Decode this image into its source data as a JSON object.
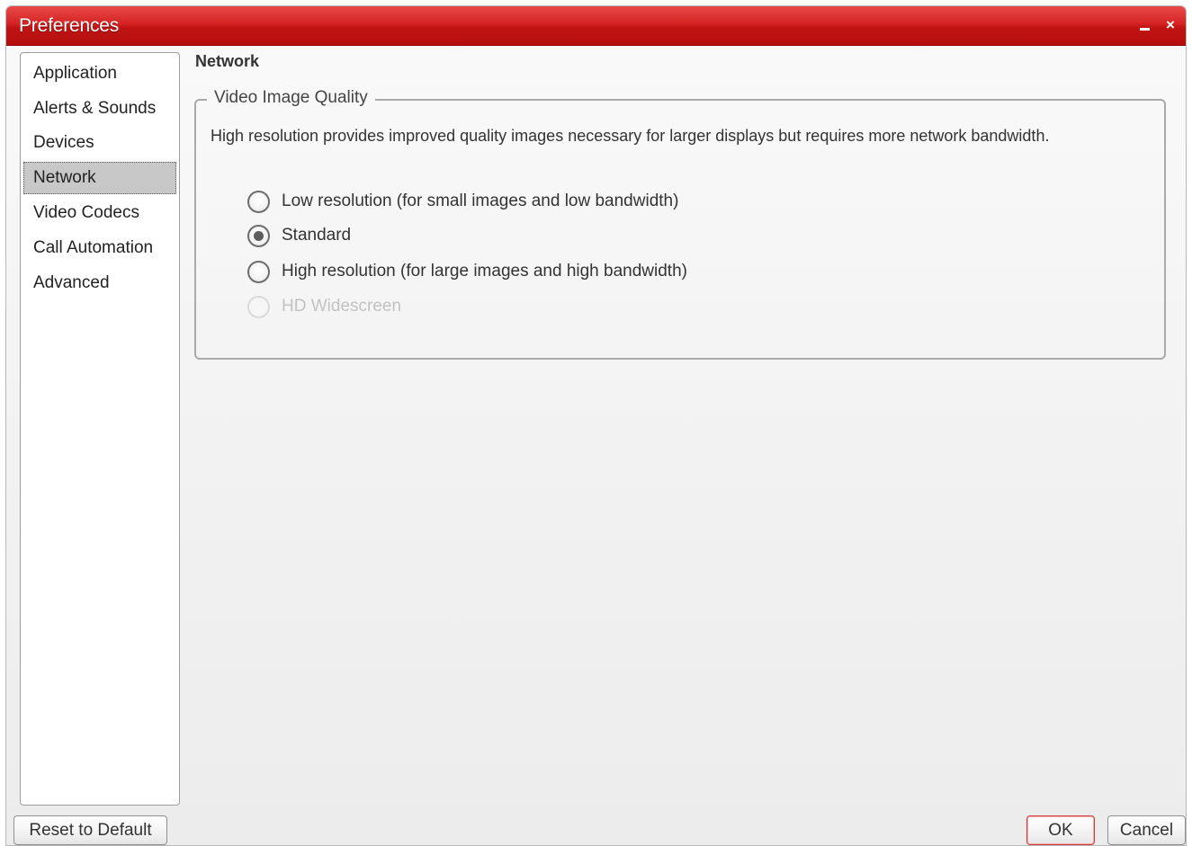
{
  "window": {
    "title": "Preferences",
    "minimize_glyph": "_",
    "close_glyph": "×"
  },
  "sidebar": {
    "items": [
      {
        "label": "Application"
      },
      {
        "label": "Alerts & Sounds"
      },
      {
        "label": "Devices"
      },
      {
        "label": "Network",
        "selected": true
      },
      {
        "label": "Video Codecs"
      },
      {
        "label": "Call Automation"
      },
      {
        "label": "Advanced"
      }
    ]
  },
  "main": {
    "section_title": "Network",
    "video_quality": {
      "legend": "Video Image Quality",
      "description": "High resolution provides improved quality images necessary for larger displays but requires more network bandwidth.",
      "options": [
        {
          "label": "Low resolution (for small images and low bandwidth)",
          "checked": false,
          "disabled": false
        },
        {
          "label": "Standard",
          "checked": true,
          "disabled": false
        },
        {
          "label": "High resolution (for large images and high bandwidth)",
          "checked": false,
          "disabled": false
        },
        {
          "label": "HD Widescreen",
          "checked": false,
          "disabled": true
        }
      ]
    }
  },
  "footer": {
    "reset_label": "Reset to Default",
    "ok_label": "OK",
    "cancel_label": "Cancel"
  },
  "colors": {
    "titlebar_red": "#c81a1a",
    "ok_border": "#d23b3b",
    "selected_item_bg": "#c8c8c8"
  }
}
